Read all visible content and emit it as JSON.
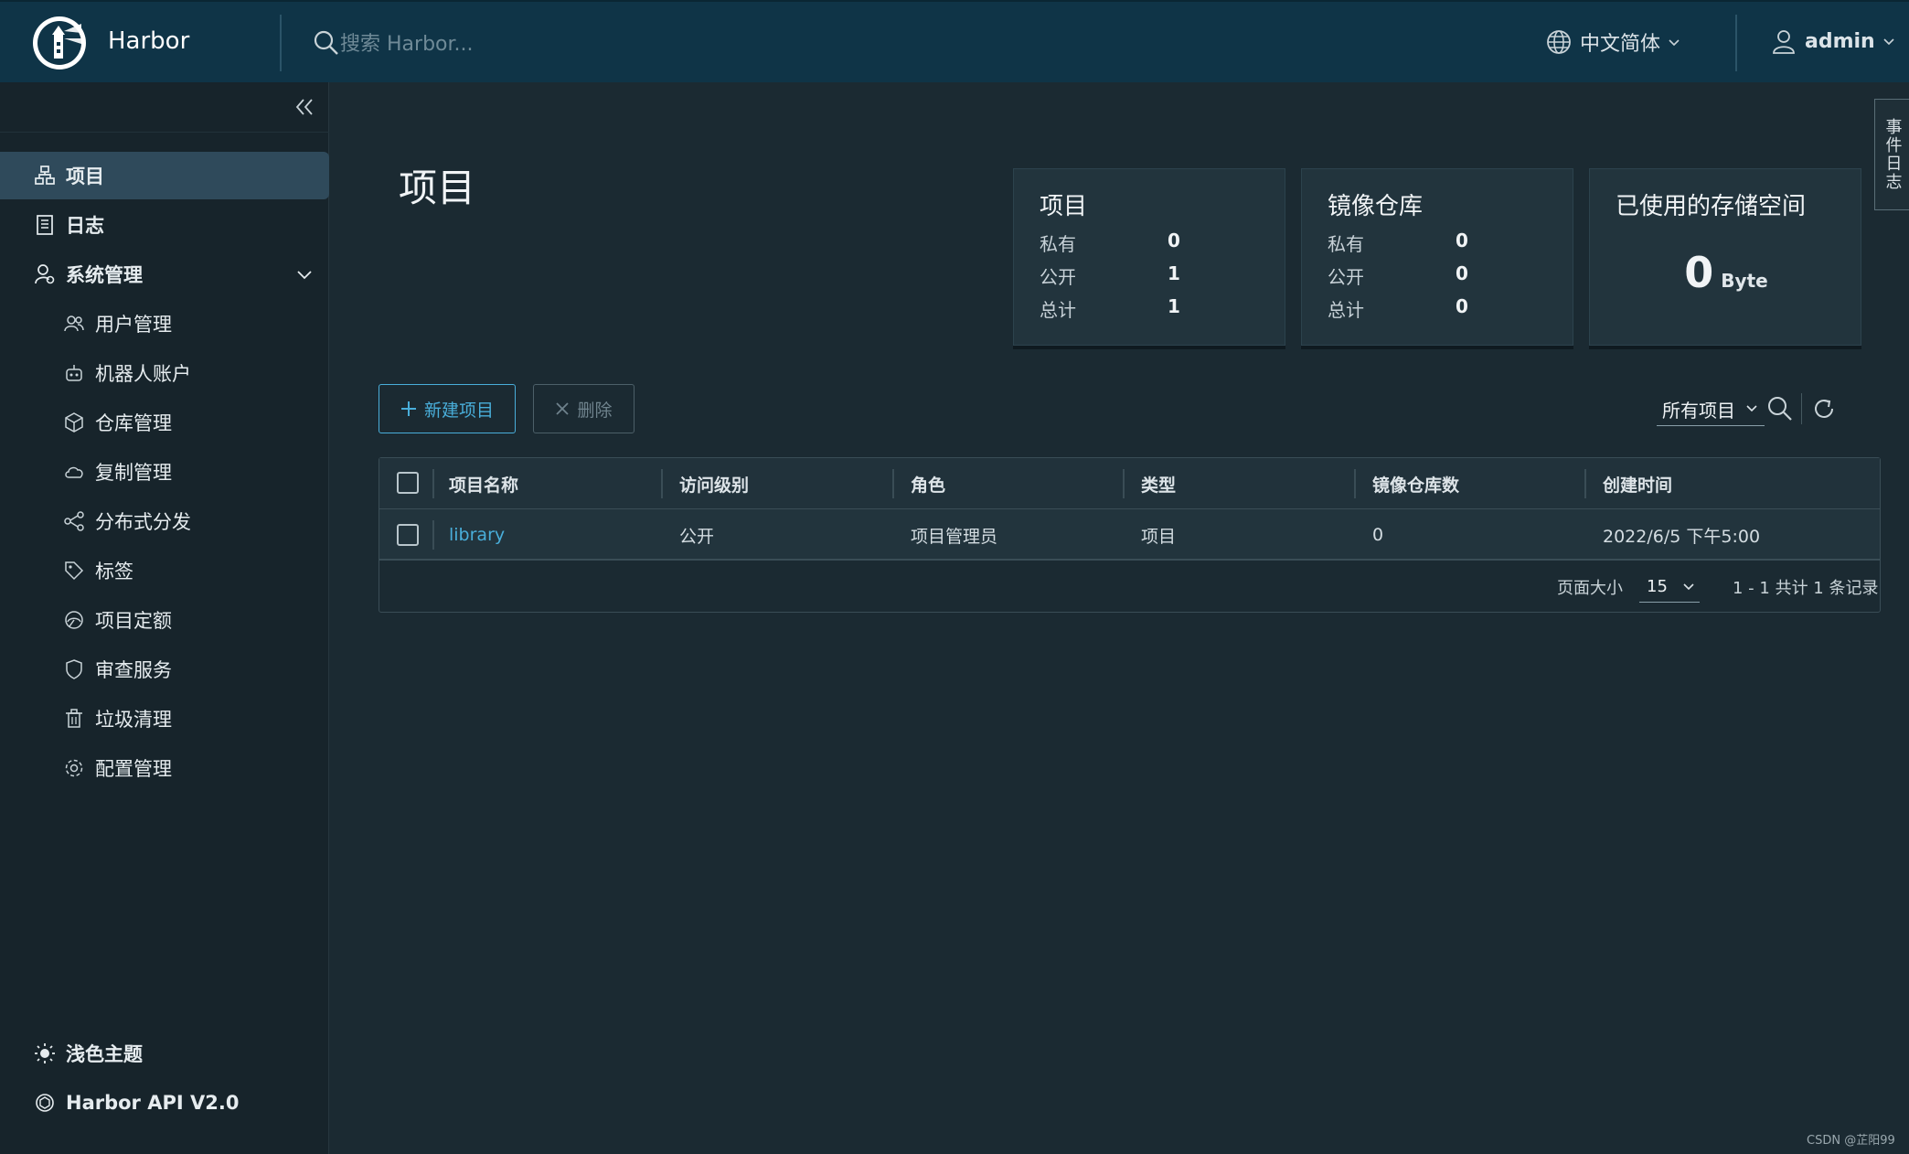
{
  "header": {
    "brand": "Harbor",
    "search_placeholder": "搜索 Harbor...",
    "language": "中文简体",
    "user": "admin"
  },
  "sidebar": {
    "items": [
      {
        "label": "项目",
        "icon": "projects-icon",
        "active": true
      },
      {
        "label": "日志",
        "icon": "logs-icon"
      },
      {
        "label": "系统管理",
        "icon": "admin-icon"
      }
    ],
    "sub_items": [
      {
        "label": "用户管理",
        "icon": "users-icon"
      },
      {
        "label": "机器人账户",
        "icon": "robot-icon"
      },
      {
        "label": "仓库管理",
        "icon": "box-icon"
      },
      {
        "label": "复制管理",
        "icon": "cloud-sync-icon"
      },
      {
        "label": "分布式分发",
        "icon": "share-icon"
      },
      {
        "label": "标签",
        "icon": "tag-icon"
      },
      {
        "label": "项目定额",
        "icon": "quota-icon"
      },
      {
        "label": "审查服务",
        "icon": "shield-icon"
      },
      {
        "label": "垃圾清理",
        "icon": "trash-icon"
      },
      {
        "label": "配置管理",
        "icon": "gear-icon"
      }
    ],
    "bottom": {
      "theme": "浅色主题",
      "api": "Harbor API V2.0"
    }
  },
  "main": {
    "title": "项目",
    "cards": {
      "projects": {
        "title": "项目",
        "rows": [
          {
            "label": "私有",
            "value": "0"
          },
          {
            "label": "公开",
            "value": "1"
          },
          {
            "label": "总计",
            "value": "1"
          }
        ]
      },
      "repos": {
        "title": "镜像仓库",
        "rows": [
          {
            "label": "私有",
            "value": "0"
          },
          {
            "label": "公开",
            "value": "0"
          },
          {
            "label": "总计",
            "value": "0"
          }
        ]
      },
      "storage": {
        "title": "已使用的存储空间",
        "value": "0",
        "unit": "Byte"
      }
    },
    "toolbar": {
      "new_label": "新建项目",
      "delete_label": "删除",
      "filter": "所有项目"
    },
    "table": {
      "columns": [
        "项目名称",
        "访问级别",
        "角色",
        "类型",
        "镜像仓库数",
        "创建时间"
      ],
      "rows": [
        [
          "library",
          "公开",
          "项目管理员",
          "项目",
          "0",
          "2022/6/5 下午5:00"
        ]
      ],
      "footer": {
        "page_size_label": "页面大小",
        "page_size": "15",
        "summary": "1 - 1 共计 1 条记录"
      }
    }
  },
  "edge_tab": "事件日志",
  "watermark": "CSDN @芷阳99",
  "colors": {
    "header_bg": "#0f3447",
    "accent": "#49aeda",
    "sidebar_active": "#2f4a5b"
  }
}
